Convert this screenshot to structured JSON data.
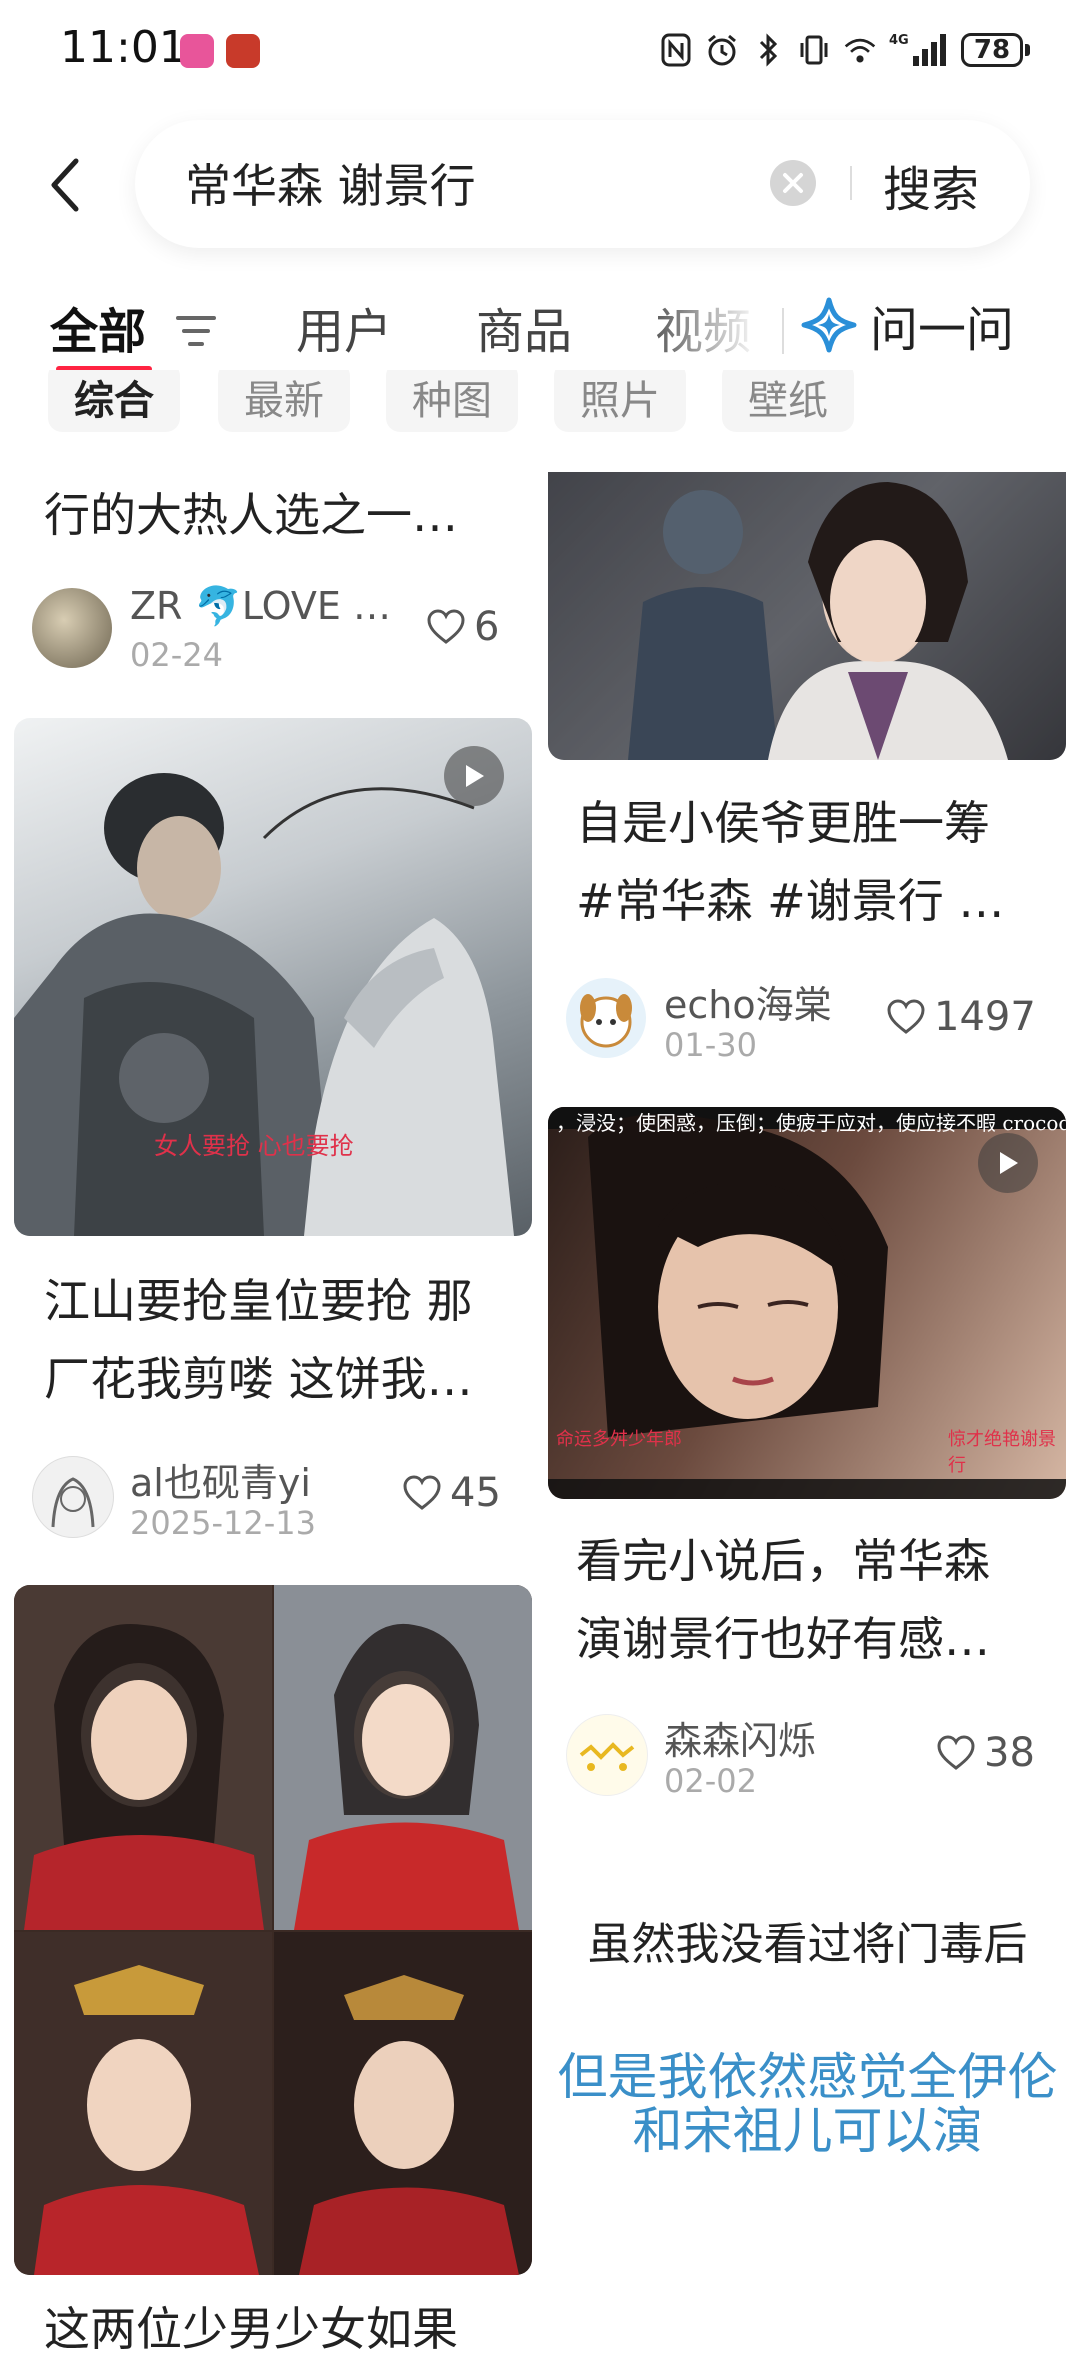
{
  "status_bar": {
    "time": "11:01",
    "network": "4G",
    "battery": "78"
  },
  "search": {
    "query": "常华森 谢景行",
    "button_label": "搜索"
  },
  "tabs": {
    "items": [
      "全部",
      "用户",
      "商品",
      "视频"
    ],
    "active": "全部",
    "ask_label": "问一问"
  },
  "chips": [
    "综合",
    "最新",
    "种图",
    "照片",
    "壁纸"
  ],
  "feed": {
    "left": [
      {
        "title_lines": [
          "行的大热人选之一…"
        ],
        "author": "ZR 🐬LOVE …",
        "date": "02-24",
        "likes": "6"
      },
      {
        "video_caption": "女人要抢  心也要抢",
        "title_lines": [
          "江山要抢皇位要抢 那",
          "厂花我剪喽 这饼我…"
        ],
        "author": "al也砚青yi",
        "date": "2025-12-13",
        "likes": "45"
      },
      {
        "title_lines": [
          "这两位少男少女如果"
        ]
      }
    ],
    "right": [
      {
        "title_lines": [
          "自是小侯爷更胜一筹",
          "#常华森 #谢景行 …"
        ],
        "author": "echo海棠",
        "date": "01-30",
        "likes": "1497"
      },
      {
        "video_top_caption": "，浸没；使困惑，压倒；使疲于应对，使应接不暇    crocodi",
        "video_side_caption_left": "命运多舛少年郎",
        "video_side_caption_right": "惊才绝艳谢景行",
        "title_lines": [
          "看完小说后，常华森",
          "演谢景行也好有感…"
        ],
        "author": "森森闪烁",
        "date": "02-02",
        "likes": "38"
      },
      {
        "note_line1": "虽然我没看过将门毒后",
        "note_line2": "但是我依然感觉全伊伦和宋祖儿可以演"
      }
    ]
  },
  "colors": {
    "accent": "#ff2442",
    "ask_icon": "#2a8fd8",
    "note_blue": "#3a8fc8"
  }
}
